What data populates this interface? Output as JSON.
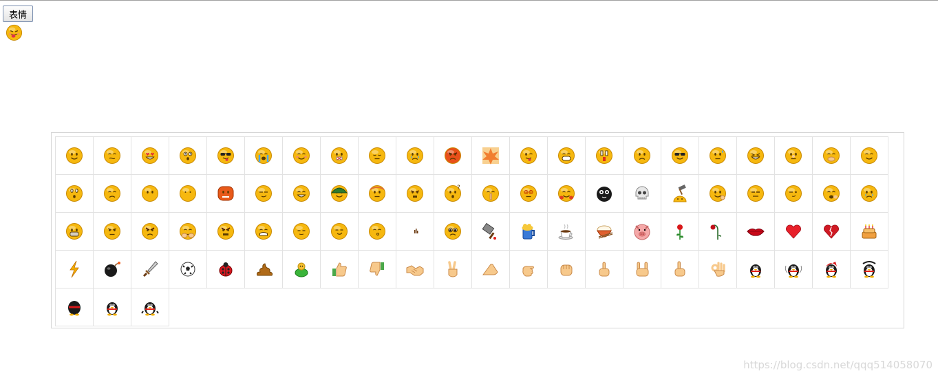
{
  "toolbar": {
    "emoji_button_label": "表情"
  },
  "selected": {
    "icon": "tongue-face-icon"
  },
  "grid": {
    "rows": [
      [
        "smile-face-icon",
        "grimace-face-icon",
        "heart-eyes-face-icon",
        "surprised-face-icon",
        "sunglasses-cool-face-icon",
        "crying-loud-face-icon",
        "shy-face-icon",
        "mouth-shut-face-icon",
        "sleep-face-icon",
        "tearful-face-icon",
        "angry-red-face-icon",
        "fire-burst-icon",
        "wink-tongue-face-icon",
        "big-grin-face-icon",
        "shocked-face-icon",
        "frown-face-icon",
        "cool-shades-face-icon",
        "sweat-face-icon",
        "laugh-squint-face-icon",
        "nose-pick-face-icon",
        "cover-mouth-face-icon",
        "content-face-icon"
      ],
      [
        "puzzled-face-icon",
        "sad-frown-face-icon",
        "kiss-face-icon",
        "blank-face-icon",
        "pouting-red-face-icon",
        "smirk-face-icon",
        "grin-face-icon",
        "army-helmet-face-icon",
        "sweating-face-icon",
        "curse-face-icon",
        "question-face-icon",
        "shush-face-icon",
        "dizzy-face-icon",
        "hug-face-icon",
        "black-sheep-icon",
        "skull-icon",
        "hammer-head-icon",
        "waving-face-icon",
        "sneer-face-icon",
        "side-look-face-icon",
        "yawn-face-icon",
        "sob-face-icon"
      ],
      [
        "toothy-grin-face-icon",
        "glare-face-icon",
        "angry-face-icon",
        "cover-face-icon",
        "rage-face-icon",
        "worried-face-icon",
        "sleepy-face-icon",
        "smug-face-icon",
        "blow-kiss-face-icon",
        "signal-bars-icon",
        "pitiful-face-icon",
        "cleaver-knife-icon",
        "beer-mug-icon",
        "coffee-cup-icon",
        "rice-bowl-icon",
        "pig-face-icon",
        "red-rose-icon",
        "wilted-rose-icon",
        "red-lips-icon",
        "red-heart-icon",
        "broken-heart-icon",
        "birthday-cake-icon"
      ],
      [
        "lightning-bolt-icon",
        "bomb-icon",
        "dagger-icon",
        "soccer-ball-icon",
        "ladybug-icon",
        "poop-icon",
        "green-frog-icon",
        "thumbs-up-icon",
        "thumbs-down-icon",
        "handshake-icon",
        "victory-hand-icon",
        "salute-hand-icon",
        "pinky-hand-icon",
        "fist-icon",
        "beckon-finger-icon",
        "rock-horns-hand-icon",
        "pointing-up-icon",
        "ok-hand-icon",
        "penguin-icon",
        "penguin-spin-icon",
        "penguin-red-icon",
        "penguin-big-icon"
      ],
      [
        "penguin-dark-icon",
        "penguin-small-icon",
        "penguin-walk-icon"
      ]
    ]
  },
  "watermark": {
    "text": "https://blog.csdn.net/qqq514058070"
  },
  "colors": {
    "face_yellow": "#f6b80f",
    "face_outline": "#c98a00",
    "grid_border": "#e2e2e2",
    "panel_border": "#d6d6d6"
  }
}
